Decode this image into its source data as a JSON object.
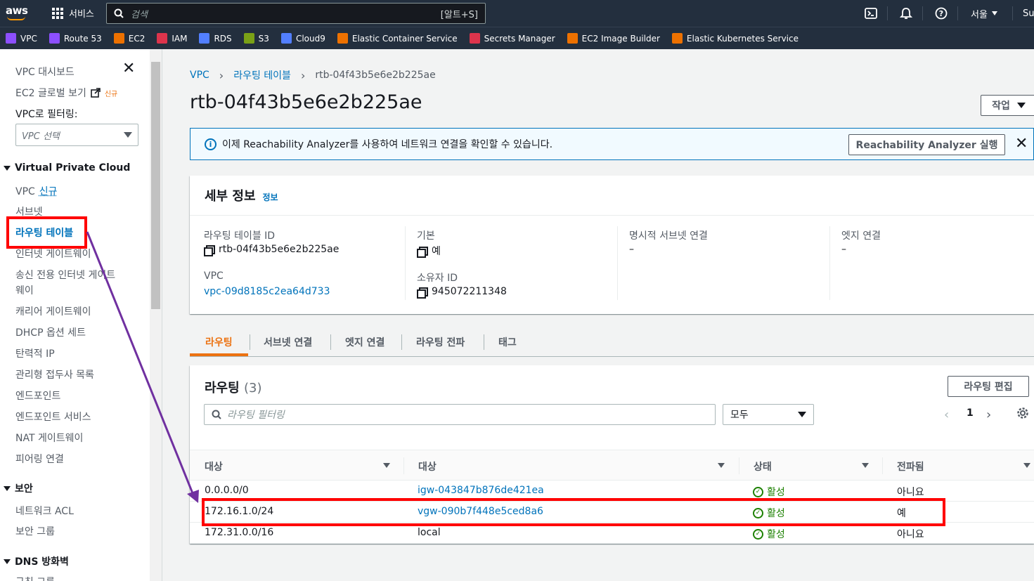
{
  "topnav": {
    "logo": "aws",
    "services_label": "서비스",
    "search_placeholder": "검색",
    "search_shortcut": "[알트+S]",
    "region_label": "서울",
    "account_label": "Su",
    "icons": [
      "cloudshell-icon",
      "notifications-icon",
      "help-icon"
    ]
  },
  "favorites": [
    {
      "label": "VPC",
      "color": "#8c4fff"
    },
    {
      "label": "Route 53",
      "color": "#8c4fff"
    },
    {
      "label": "EC2",
      "color": "#ed7100"
    },
    {
      "label": "IAM",
      "color": "#dd344c"
    },
    {
      "label": "RDS",
      "color": "#527fff"
    },
    {
      "label": "S3",
      "color": "#7aa116"
    },
    {
      "label": "Cloud9",
      "color": "#527fff"
    },
    {
      "label": "Elastic Container Service",
      "color": "#ed7100"
    },
    {
      "label": "Secrets Manager",
      "color": "#dd344c"
    },
    {
      "label": "EC2 Image Builder",
      "color": "#ed7100"
    },
    {
      "label": "Elastic Kubernetes Service",
      "color": "#ed7100"
    }
  ],
  "sidebar": {
    "dashboard": "VPC 대시보드",
    "ec2_global": "EC2 글로벌 보기",
    "new_badge": "신규",
    "filter_label": "VPC로 필터링:",
    "filter_placeholder": "VPC 선택",
    "section_vpc": "Virtual Private Cloud",
    "items_vpc": [
      "VPC",
      "서브넷",
      "라우팅 테이블",
      "인터넷 게이트웨이",
      "송신 전용 인터넷 게이트",
      "웨이",
      "캐리어 게이트웨이",
      "DHCP 옵션 세트",
      "탄력적 IP",
      "관리형 접두사 목록",
      "엔드포인트",
      "엔드포인트 서비스",
      "NAT 게이트웨이",
      "피어링 연결"
    ],
    "vpc_new": "신규",
    "section_security": "보안",
    "items_security": [
      "네트워크 ACL",
      "보안 그룹"
    ],
    "section_dns": "DNS 방화벽",
    "items_dns": [
      "규칙 그룹"
    ]
  },
  "breadcrumb": [
    "VPC",
    "라우팅 테이블",
    "rtb-04f43b5e6e2b225ae"
  ],
  "page_title": "rtb-04f43b5e6e2b225ae",
  "actions_label": "작업",
  "banner": {
    "text": "이제 Reachability Analyzer를 사용하여 네트워크 연결을 확인할 수 있습니다.",
    "button": "Reachability Analyzer 실행"
  },
  "details": {
    "title": "세부 정보",
    "info": "정보",
    "route_table_id_label": "라우팅 테이블 ID",
    "route_table_id": "rtb-04f43b5e6e2b225ae",
    "main_label": "기본",
    "main_value": "예",
    "explicit_subnet_label": "명시적 서브넷 연결",
    "explicit_subnet_value": "–",
    "edge_label": "엣지 연결",
    "edge_value": "–",
    "vpc_label": "VPC",
    "vpc_value": "vpc-09d8185c2ea64d733",
    "owner_label": "소유자 ID",
    "owner_value": "945072211348"
  },
  "tabs": [
    "라우팅",
    "서브넷 연결",
    "엣지 연결",
    "라우팅 전파",
    "태그"
  ],
  "routes": {
    "title": "라우팅",
    "count": "(3)",
    "edit_button": "라우팅 편집",
    "filter_placeholder": "라우팅 필터링",
    "filter_select": "모두",
    "page": "1",
    "columns": [
      "대상",
      "대상",
      "상태",
      "전파됨"
    ],
    "rows": [
      {
        "destination": "0.0.0.0/0",
        "target": "igw-043847b876de421ea",
        "target_link": true,
        "status": "활성",
        "propagated": "아니요"
      },
      {
        "destination": "172.16.1.0/24",
        "target": "vgw-090b7f448e5ced8a6",
        "target_link": true,
        "status": "활성",
        "propagated": "예"
      },
      {
        "destination": "172.31.0.0/16",
        "target": "local",
        "target_link": false,
        "status": "활성",
        "propagated": "아니요"
      }
    ]
  },
  "colors": {
    "nav_bg": "#232f3e",
    "link": "#0073bb",
    "accent_orange": "#ec7211",
    "success": "#1d8102",
    "annotation_red": "#ff0000",
    "annotation_arrow": "#7030a0"
  }
}
